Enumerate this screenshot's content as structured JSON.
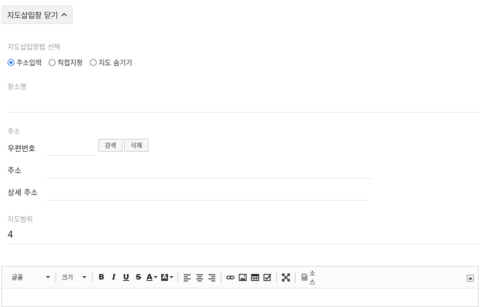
{
  "map_toggle": {
    "label": "지도삽입창 닫기"
  },
  "insert_method": {
    "label": "지도삽입방법 선택",
    "options": [
      {
        "label": "주소입력",
        "checked": true
      },
      {
        "label": "직접지정",
        "checked": false
      },
      {
        "label": "지도 숨기기",
        "checked": false
      }
    ]
  },
  "place_name": {
    "label": "장소명",
    "value": ""
  },
  "address": {
    "section_label": "주소",
    "postal_label": "우편번호",
    "postal_value": "",
    "search_button": "검색",
    "delete_button": "삭제",
    "address_label": "주소",
    "detail_label": "상세 주소"
  },
  "map_range": {
    "label": "지도범위",
    "value": "4"
  },
  "editor": {
    "font_select": "글꼴",
    "size_select": "크기",
    "bold": "B",
    "italic": "I",
    "underline": "U",
    "strike": "S",
    "font_color": "A",
    "bg_color": "A",
    "source_label": "소스"
  },
  "colors": {
    "accent": "#1a73e8",
    "border": "#e6e6e6",
    "label": "#9a9a9a"
  }
}
